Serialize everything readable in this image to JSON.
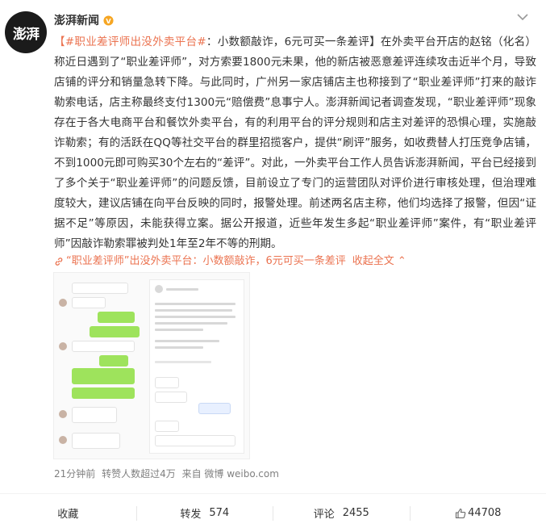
{
  "post": {
    "avatar_text": "澎湃",
    "author": "澎湃新闻",
    "hashtag": "【#职业差评师出没外卖平台#",
    "body": "：小数额敲诈，6元可买一条差评】在外卖平台开店的赵铭（化名）称近日遇到了“职业差评师”，对方索要1800元未果，他的新店被恶意差评连续攻击近半个月，导致店铺的评分和销量急转下降。与此同时，广州另一家店铺店主也称接到了“职业差评师”打来的敲诈勒索电话，店主称最终支付1300元“赔偿费”息事宁人。澎湃新闻记者调查发现，“职业差评师”现象存在于各大电商平台和餐饮外卖平台，有的利用平台的评分规则和店主对差评的恐惧心理，实施敲诈勒索；有的活跃在QQ等社交平台的群里招揽客户，提供“刷评”服务，如收费替人打压竞争店铺，不到1000元即可购买30个左右的“差评”。对此，一外卖平台工作人员告诉澎湃新闻，平台已经接到了多个关于“职业差评师”的问题反馈，目前设立了专门的运营团队对评价进行审核处理，但治理难度较大，建议店铺在向平台反映的同时，报警处理。前述两名店主称，他们均选择了报警，但因“证据不足”等原因，未能获得立案。据公开报道，近些年发生多起“职业差评师”案件，有“职业差评师”因敲诈勒索罪被判处1年至2年不等的刑期。",
    "link_title": "“职业差评师”出没外卖平台：小数额敲诈，6元可买一条差评",
    "expand_label": "收起全文",
    "expand_caret": "⌃",
    "meta": {
      "time": "21分钟前",
      "reposts_note": "转赞人数超过4万",
      "source": "来自 微博 weibo.com"
    }
  },
  "actions": {
    "favorite": "收藏",
    "repost_label": "转发",
    "repost_count": "574",
    "comment_label": "评论",
    "comment_count": "2455",
    "like_count": "44708"
  },
  "colors": {
    "accent": "#eb7350",
    "text": "#333333",
    "muted": "#808080",
    "verify": "#f6a623"
  },
  "icons": [
    "verified-badge-icon",
    "more-chevron-icon",
    "link-icon",
    "like-thumb-icon"
  ]
}
